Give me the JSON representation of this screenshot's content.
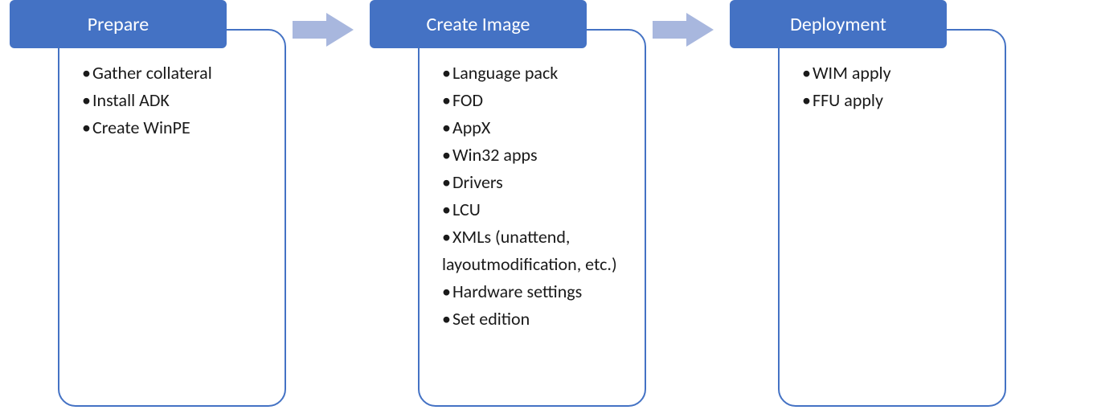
{
  "colors": {
    "accent": "#4472C4",
    "arrow": "#A8B7DE"
  },
  "stages": {
    "prepare": {
      "title": "Prepare",
      "items": [
        "Gather collateral",
        "Install ADK",
        "Create WinPE"
      ]
    },
    "create": {
      "title": "Create Image",
      "items": [
        "Language pack",
        "FOD",
        "AppX",
        "Win32 apps",
        "Drivers",
        "LCU",
        "XMLs (unattend, layoutmodification, etc.)",
        "Hardware settings",
        "Set edition"
      ]
    },
    "deploy": {
      "title": "Deployment",
      "items": [
        "WIM apply",
        "FFU apply"
      ]
    }
  }
}
